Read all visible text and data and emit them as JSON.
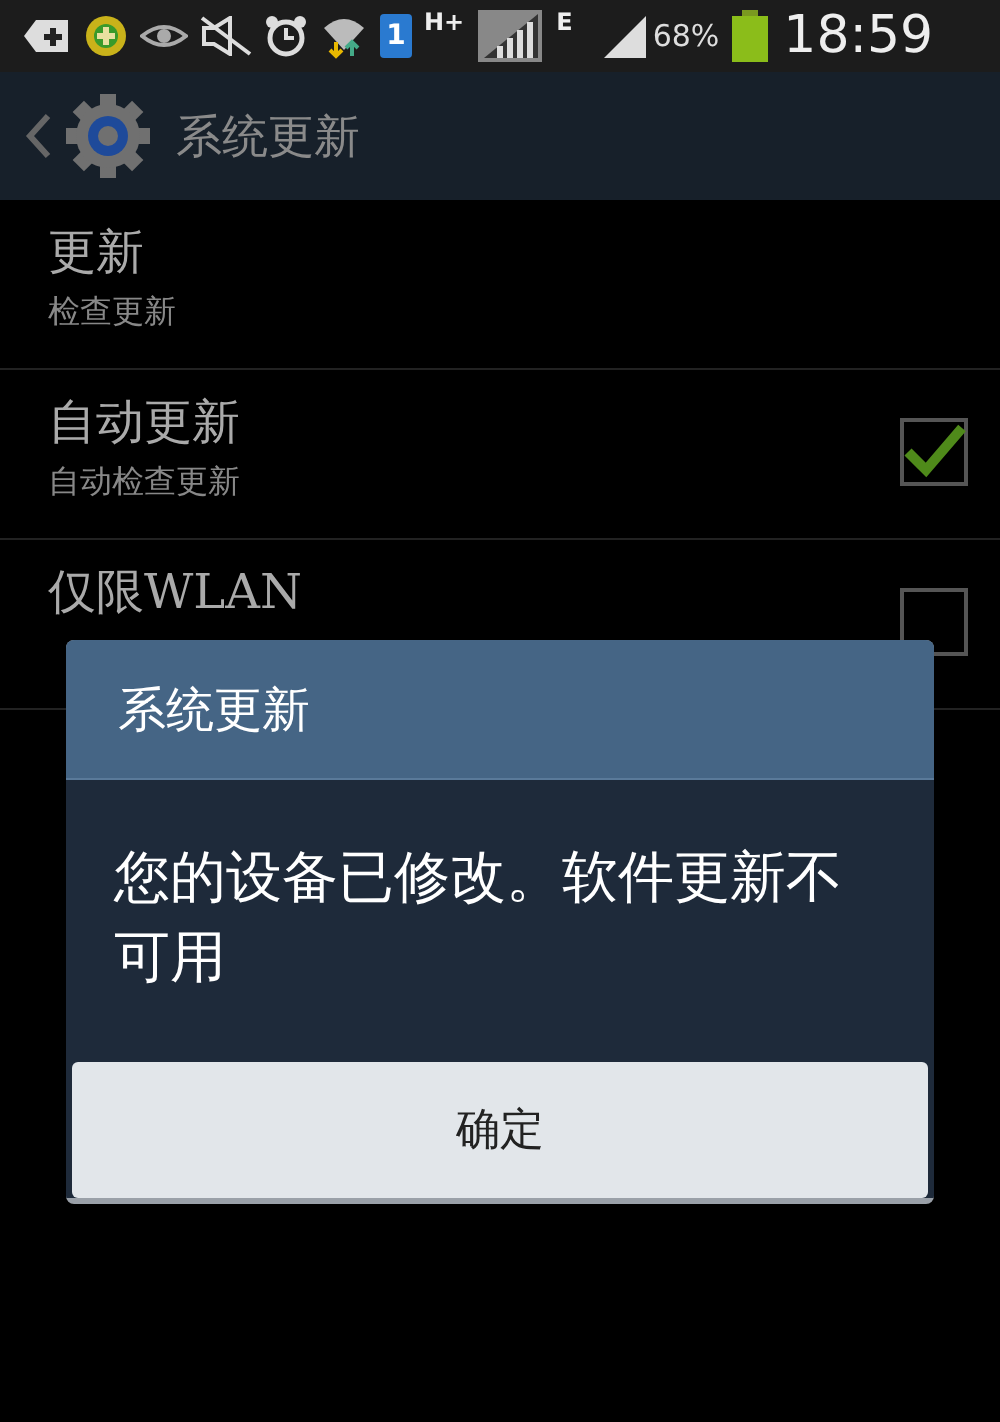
{
  "status_bar": {
    "sim_number": "1",
    "network_type": "H+",
    "network_type_2": "E",
    "battery": "68%",
    "time": "18:59"
  },
  "action_bar": {
    "title": "系统更新"
  },
  "settings": [
    {
      "kind": "plain",
      "title": "更新",
      "subtitle": "检查更新"
    },
    {
      "kind": "checkbox",
      "title": "自动更新",
      "subtitle": "自动检查更新",
      "checked": true
    },
    {
      "kind": "checkbox",
      "title": "仅限WLAN",
      "checked": false
    }
  ],
  "dialog": {
    "title": "系统更新",
    "message": "您的设备已修改。软件更新不可用",
    "buttons": [
      "确定"
    ]
  }
}
